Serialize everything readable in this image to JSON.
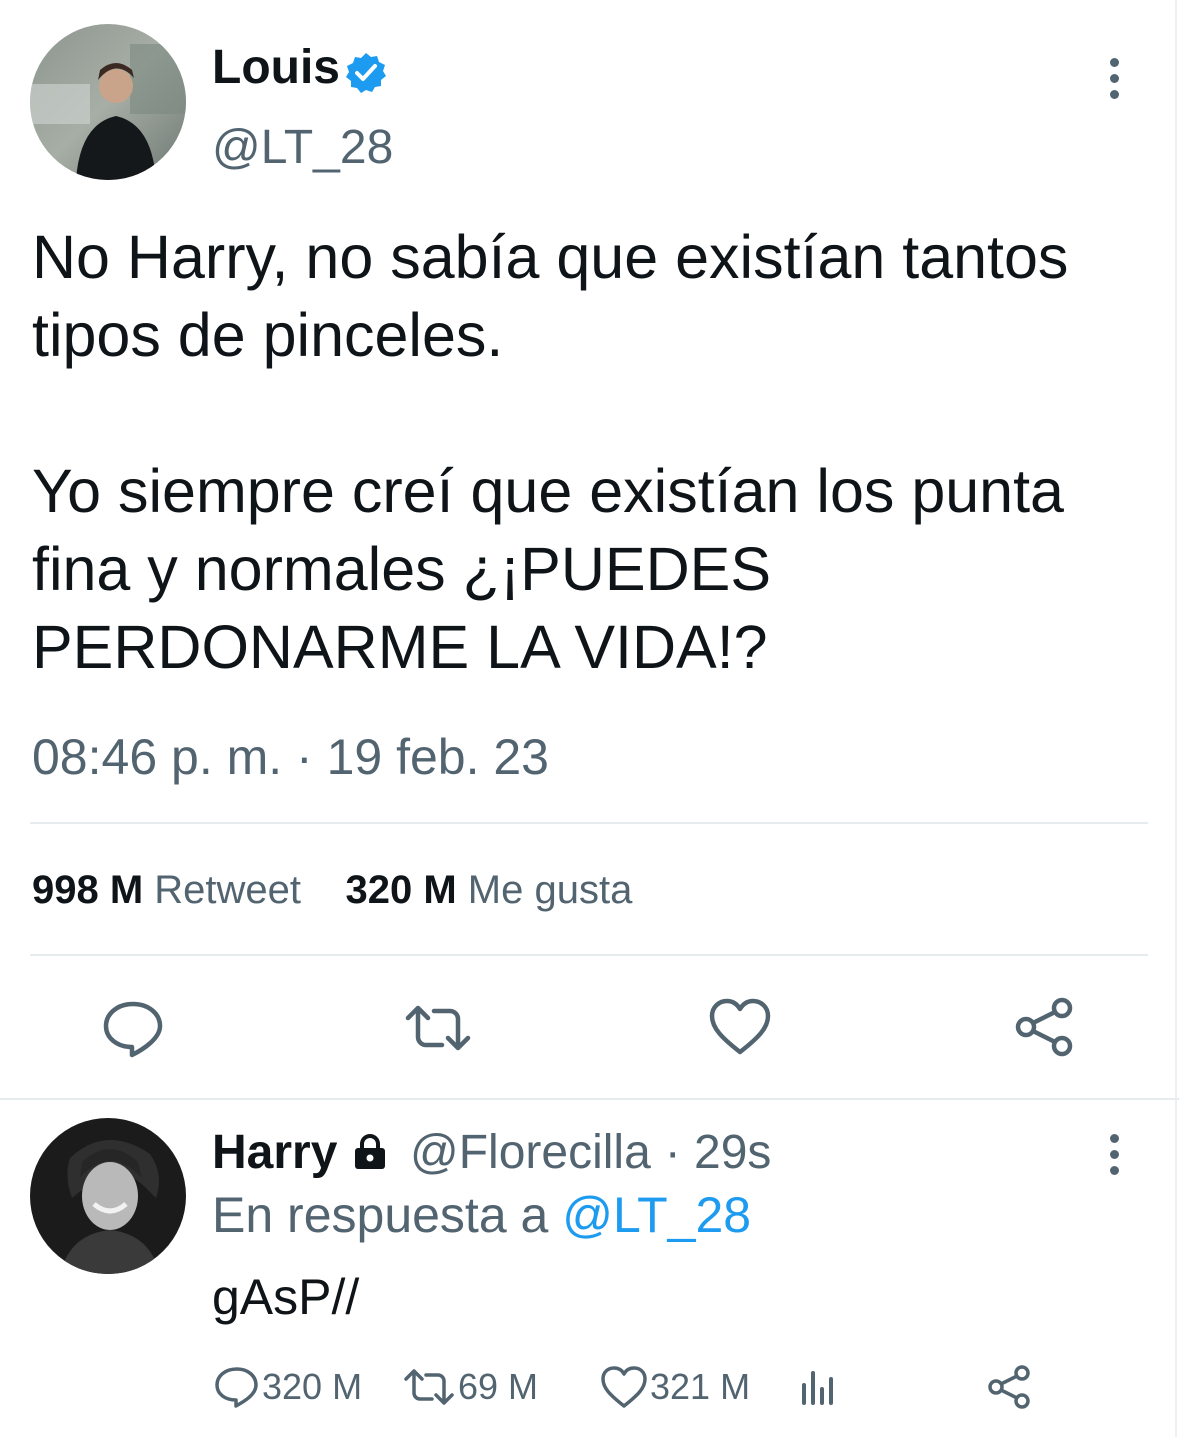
{
  "colors": {
    "text": "#0f1419",
    "secondary": "#536471",
    "link": "#1d9bf0",
    "verified": "#1d9bf0",
    "divider": "#e6ebee"
  },
  "main_tweet": {
    "author_name": "Louis",
    "verified_icon": "verified-badge-icon",
    "handle": "@LT_28",
    "text": "No Harry, no sabía que existían tantos tipos de pinceles.\n\nYo siempre creí que existían los punta fina y normales ¿¡PUEDES PERDONARME LA VIDA!?",
    "timestamp": "08:46 p. m. · 19 feb. 23",
    "retweet_count": "998 M",
    "retweet_label": "Retweet",
    "like_count": "320 M",
    "like_label": "Me gusta",
    "actions": [
      "reply-icon",
      "retweet-icon",
      "like-icon",
      "share-icon"
    ]
  },
  "reply_tweet": {
    "author_name": "Harry",
    "protected_icon": "lock-icon",
    "handle": "@Florecilla",
    "time": "· 29s",
    "reply_to_label": "En respuesta a",
    "reply_to_mention": "@LT_28",
    "text": "gAsP//",
    "reply_count": "320 M",
    "retweet_count": "69 M",
    "like_count": "321 M",
    "actions": [
      "reply-icon",
      "retweet-icon",
      "like-icon",
      "analytics-icon",
      "share-icon"
    ]
  }
}
